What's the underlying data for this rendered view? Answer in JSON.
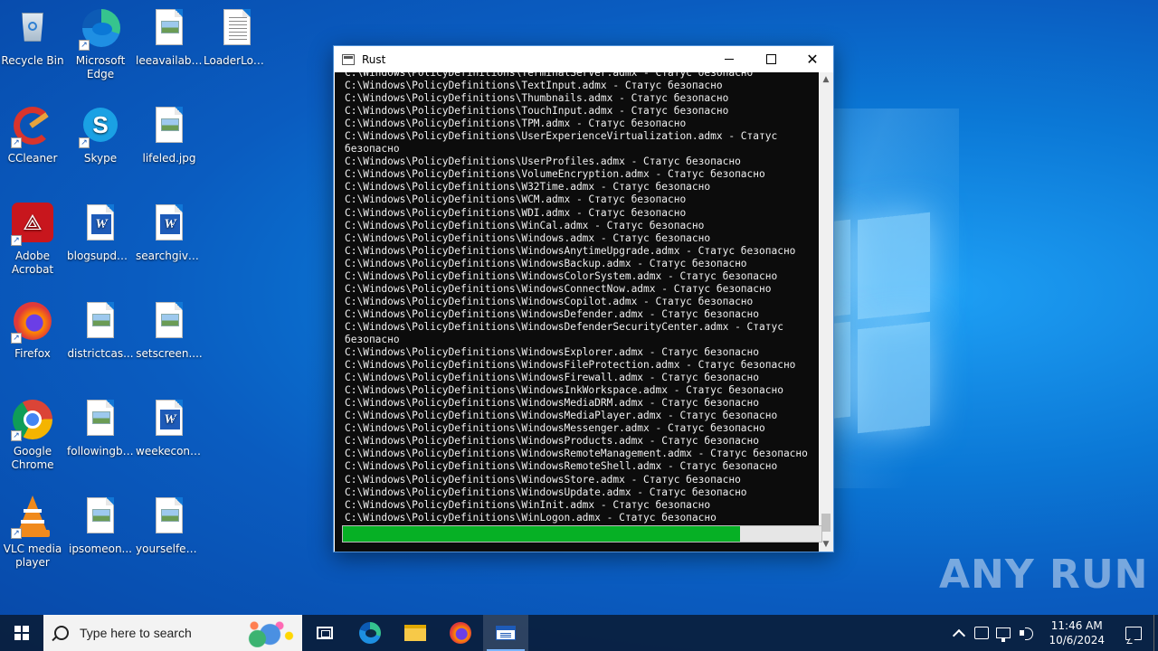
{
  "desktop": {
    "icons": [
      {
        "label": "Recycle Bin",
        "icon": "recycle-bin-icon"
      },
      {
        "label": "Microsoft Edge",
        "icon": "edge-icon"
      },
      {
        "label": "leeavailabili...",
        "icon": "image-file-icon"
      },
      {
        "label": "LoaderLog....",
        "icon": "text-file-icon"
      },
      {
        "label": "CCleaner",
        "icon": "ccleaner-icon"
      },
      {
        "label": "Skype",
        "icon": "skype-icon"
      },
      {
        "label": "lifeled.jpg",
        "icon": "image-file-icon"
      },
      {
        "label": "Adobe Acrobat",
        "icon": "acrobat-icon"
      },
      {
        "label": "blogsupdat...",
        "icon": "word-file-icon"
      },
      {
        "label": "searchgive.rtf",
        "icon": "word-file-icon"
      },
      {
        "label": "Firefox",
        "icon": "firefox-icon"
      },
      {
        "label": "districtcas...",
        "icon": "image-file-icon"
      },
      {
        "label": "setscreen....",
        "icon": "image-file-icon"
      },
      {
        "label": "Google Chrome",
        "icon": "chrome-icon"
      },
      {
        "label": "followingbi...",
        "icon": "image-file-icon"
      },
      {
        "label": "weekecono...",
        "icon": "word-file-icon"
      },
      {
        "label": "VLC media player",
        "icon": "vlc-icon"
      },
      {
        "label": "ipsomeon...",
        "icon": "image-file-icon"
      },
      {
        "label": "yourselfeve...",
        "icon": "image-file-icon"
      }
    ]
  },
  "window": {
    "title": "Rust",
    "console_lines": [
      "C:\\Windows\\PolicyDefinitions\\TerminalServer.admx - Статус безопасно",
      "C:\\Windows\\PolicyDefinitions\\TextInput.admx - Статус безопасно",
      "C:\\Windows\\PolicyDefinitions\\Thumbnails.admx - Статус безопасно",
      "C:\\Windows\\PolicyDefinitions\\TouchInput.admx - Статус безопасно",
      "C:\\Windows\\PolicyDefinitions\\TPM.admx - Статус безопасно",
      "C:\\Windows\\PolicyDefinitions\\UserExperienceVirtualization.admx - Статус",
      "безопасно",
      "C:\\Windows\\PolicyDefinitions\\UserProfiles.admx - Статус безопасно",
      "C:\\Windows\\PolicyDefinitions\\VolumeEncryption.admx - Статус безопасно",
      "C:\\Windows\\PolicyDefinitions\\W32Time.admx - Статус безопасно",
      "C:\\Windows\\PolicyDefinitions\\WCM.admx - Статус безопасно",
      "C:\\Windows\\PolicyDefinitions\\WDI.admx - Статус безопасно",
      "C:\\Windows\\PolicyDefinitions\\WinCal.admx - Статус безопасно",
      "C:\\Windows\\PolicyDefinitions\\Windows.admx - Статус безопасно",
      "C:\\Windows\\PolicyDefinitions\\WindowsAnytimeUpgrade.admx - Статус безопасно",
      "C:\\Windows\\PolicyDefinitions\\WindowsBackup.admx - Статус безопасно",
      "C:\\Windows\\PolicyDefinitions\\WindowsColorSystem.admx - Статус безопасно",
      "C:\\Windows\\PolicyDefinitions\\WindowsConnectNow.admx - Статус безопасно",
      "C:\\Windows\\PolicyDefinitions\\WindowsCopilot.admx - Статус безопасно",
      "C:\\Windows\\PolicyDefinitions\\WindowsDefender.admx - Статус безопасно",
      "C:\\Windows\\PolicyDefinitions\\WindowsDefenderSecurityCenter.admx - Статус",
      "безопасно",
      "C:\\Windows\\PolicyDefinitions\\WindowsExplorer.admx - Статус безопасно",
      "C:\\Windows\\PolicyDefinitions\\WindowsFileProtection.admx - Статус безопасно",
      "C:\\Windows\\PolicyDefinitions\\WindowsFirewall.admx - Статус безопасно",
      "C:\\Windows\\PolicyDefinitions\\WindowsInkWorkspace.admx - Статус безопасно",
      "C:\\Windows\\PolicyDefinitions\\WindowsMediaDRM.admx - Статус безопасно",
      "C:\\Windows\\PolicyDefinitions\\WindowsMediaPlayer.admx - Статус безопасно",
      "C:\\Windows\\PolicyDefinitions\\WindowsMessenger.admx - Статус безопасно",
      "C:\\Windows\\PolicyDefinitions\\WindowsProducts.admx - Статус безопасно",
      "C:\\Windows\\PolicyDefinitions\\WindowsRemoteManagement.admx - Статус безопасно",
      "C:\\Windows\\PolicyDefinitions\\WindowsRemoteShell.admx - Статус безопасно",
      "C:\\Windows\\PolicyDefinitions\\WindowsStore.admx - Статус безопасно",
      "C:\\Windows\\PolicyDefinitions\\WindowsUpdate.admx - Статус безопасно",
      "C:\\Windows\\PolicyDefinitions\\WinInit.admx - Статус безопасно",
      "C:\\Windows\\PolicyDefinitions\\WinLogon.admx - Статус безопасно"
    ],
    "progress_fraction": 0.83,
    "progress_color": "#06b025"
  },
  "watermark": "ANY RUN",
  "taskbar": {
    "search_placeholder": "Type here to search",
    "apps": [
      "task-view-icon",
      "edge-icon",
      "file-explorer-icon",
      "firefox-icon",
      "console-app-icon"
    ],
    "time": "11:46 AM",
    "date": "10/6/2024"
  }
}
